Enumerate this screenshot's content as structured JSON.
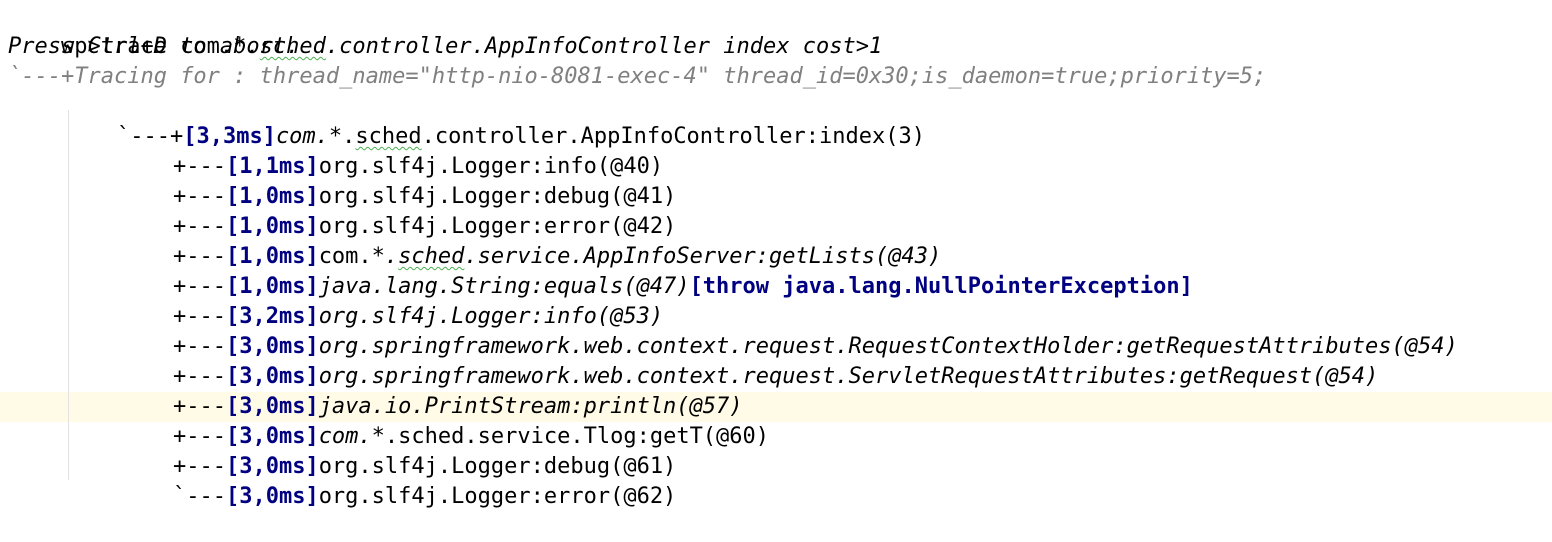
{
  "colors": {
    "background": "#ffffff",
    "text": "#000000",
    "comment": "#808080",
    "timing": "#000080",
    "current_line": "#fffbe6"
  },
  "console": {
    "command": {
      "prompt": "wp>trace com.",
      "star": "*",
      "sep": ".",
      "pkg": "sched",
      "rest": ".controller.AppInfoController index cost>1"
    },
    "abort_hint": "Press Ctrl+D to abort.",
    "tracing_header": "`---+Tracing for : thread_name=\"http-nio-8081-exec-4\" thread_id=0x30;is_daemon=true;priority=5;",
    "root": {
      "prefix": "`---+",
      "timing": "[3,3ms]",
      "a": "com.",
      "star": "*",
      "sep": ".",
      "pkg": "sched",
      "b": ".controller.AppInfoController:index(3)"
    },
    "entries": [
      {
        "prefix": "+---",
        "timing": "[1,1ms]",
        "call": "org.slf4j.Logger:info(@40)"
      },
      {
        "prefix": "+---",
        "timing": "[1,0ms]",
        "call": "org.slf4j.Logger:debug(@41)"
      },
      {
        "prefix": "+---",
        "timing": "[1,0ms]",
        "call": "org.slf4j.Logger:error(@42)"
      },
      {
        "prefix": "+---",
        "timing": "[1,0ms]",
        "a": "com.",
        "star": "*",
        "sep": ".",
        "pkg": "sched",
        "b": ".service.AppInfoServer:getLists(@43)"
      },
      {
        "prefix": "+---",
        "timing": "[1,0ms]",
        "call": "java.lang.String:equals(@47)",
        "exception": "[throw java.lang.NullPointerException]"
      },
      {
        "prefix": "+---",
        "timing": "[3,2ms]",
        "call": "org.slf4j.Logger:info(@53)"
      },
      {
        "prefix": "+---",
        "timing": "[3,0ms]",
        "call": "org.springframework.web.context.request.RequestContextHolder:getRequestAttributes(@54)"
      },
      {
        "prefix": "+---",
        "timing": "[3,0ms]",
        "call": "org.springframework.web.context.request.ServletRequestAttributes:getRequest(@54)"
      },
      {
        "prefix": "+---",
        "timing": "[3,0ms]",
        "call": "java.io.PrintStream:println(@57)"
      },
      {
        "prefix": "+---",
        "timing": "[3,0ms]",
        "a": "com.",
        "star": "*",
        "sep": ".",
        "b": "sched.service.Tlog:getT(@60)"
      },
      {
        "prefix": "+---",
        "timing": "[3,0ms]",
        "call": "org.slf4j.Logger:debug(@61)"
      },
      {
        "prefix": "`---",
        "timing": "[3,0ms]",
        "call": "org.slf4j.Logger:error(@62)"
      }
    ]
  }
}
